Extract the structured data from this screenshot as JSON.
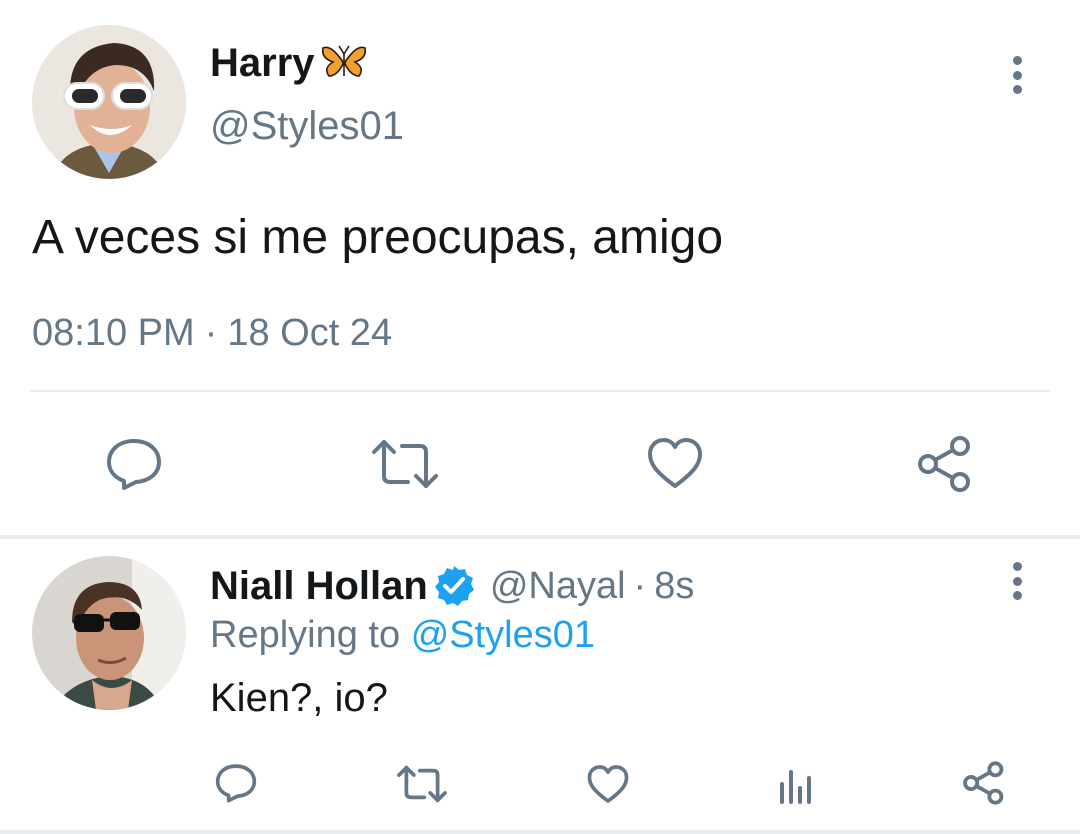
{
  "main_tweet": {
    "author_name": "Harry",
    "name_emoji": "butterfly",
    "handle": "@Styles01",
    "text": "A veces si me preocupas, amigo",
    "time": "08:10 PM",
    "separator": "·",
    "date": "18 Oct 24",
    "actions": [
      "reply",
      "retweet",
      "like",
      "share"
    ]
  },
  "reply_tweet": {
    "author_name": "Niall Hollan",
    "verified": true,
    "handle": "@Nayal",
    "separator": "·",
    "age": "8s",
    "replying_prefix": "Replying to",
    "replying_to": "@Styles01",
    "text": "Kien?, io?",
    "actions": [
      "reply",
      "retweet",
      "like",
      "analytics",
      "share"
    ]
  },
  "colors": {
    "text": "#14171a",
    "secondary": "#657786",
    "link": "#1da1f2",
    "divider": "#e6ecf0",
    "icon": "#657786"
  }
}
